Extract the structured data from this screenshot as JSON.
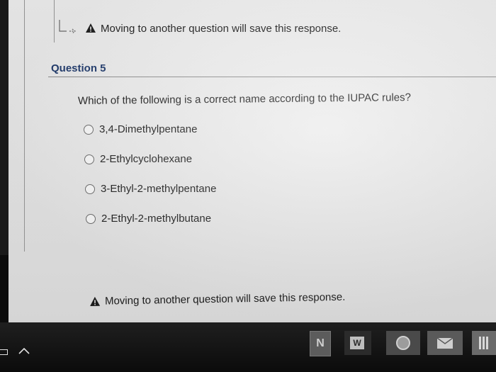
{
  "notices": {
    "top": "Moving to another question will save this response.",
    "bottom": "Moving to another question will save this response."
  },
  "question": {
    "title": "Question 5",
    "prompt": "Which of the following is a correct name according to the IUPAC rules?",
    "options": [
      "3,4-Dimethylpentane",
      "2-Ethylcyclohexane",
      "3-Ethyl-2-methylpentane",
      "2-Ethyl-2-methylbutane"
    ]
  },
  "taskbar": {
    "onenote_letter": "N",
    "word_letter": "W"
  },
  "icons": {
    "notice": "warning-triangle-icon",
    "navigate": "return-arrow-icon"
  },
  "colors": {
    "title": "#1f3a6d",
    "text": "#1d1d1d",
    "screen_bg": "#ececec",
    "taskbar_bg": "#121212"
  }
}
